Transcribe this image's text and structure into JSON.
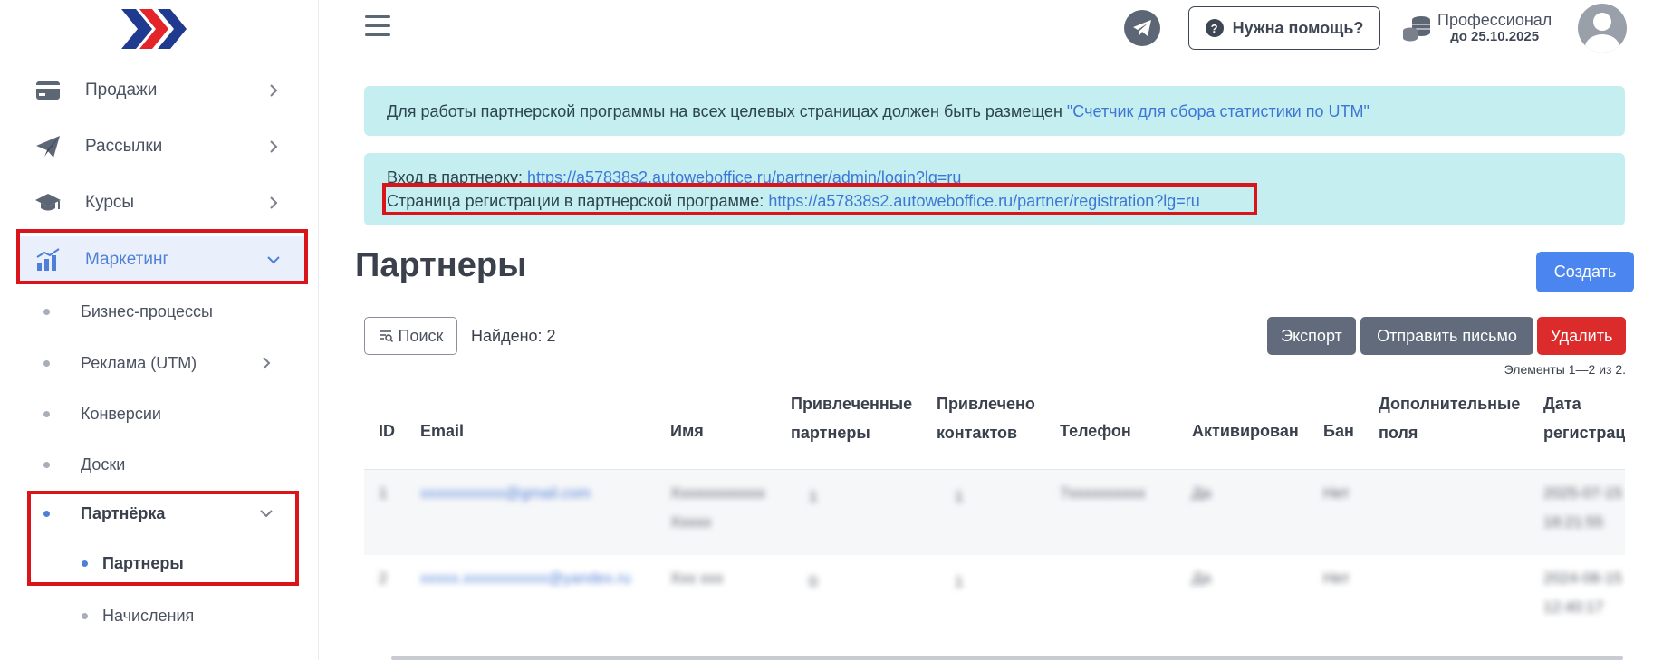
{
  "sidebar": {
    "items": [
      {
        "label": "Продажи"
      },
      {
        "label": "Рассылки"
      },
      {
        "label": "Курсы"
      },
      {
        "label": "Маркетинг"
      }
    ],
    "sub_items": [
      {
        "label": "Бизнес-процессы"
      },
      {
        "label": "Реклама (UTM)"
      },
      {
        "label": "Конверсии"
      },
      {
        "label": "Доски"
      },
      {
        "label": "Партнёрка"
      }
    ],
    "subsub_items": [
      {
        "label": "Партнеры"
      },
      {
        "label": "Начисления"
      }
    ]
  },
  "header": {
    "help_label": "Нужна помощь?",
    "plan_name": "Профессионал",
    "plan_until": "до 25.10.2025"
  },
  "alerts": {
    "utm_text": "Для работы партнерской программы на всех целевых страницах должен быть размещен ",
    "utm_link": "\"Счетчик для сбора статистики по UTM\"",
    "login_label": "Вход в партнерку: ",
    "login_url": "https://a57838s2.autoweboffice.ru/partner/admin/login?lg=ru",
    "reg_label": "Страница регистрации в партнерской программе: ",
    "reg_url": "https://a57838s2.autoweboffice.ru/partner/registration?lg=ru"
  },
  "page": {
    "title": "Партнеры",
    "create_label": "Создать",
    "search_label": "Поиск",
    "found_label": "Найдено: 2",
    "export_label": "Экспорт",
    "send_label": "Отправить письмо",
    "delete_label": "Удалить",
    "elements_count": "Элементы 1—2 из 2."
  },
  "table": {
    "columns": [
      {
        "l1": "ID",
        "l2": ""
      },
      {
        "l1": "Email",
        "l2": ""
      },
      {
        "l1": "Имя",
        "l2": ""
      },
      {
        "l1": "Привлеченные",
        "l2": "партнеры"
      },
      {
        "l1": "Привлечено",
        "l2": "контактов"
      },
      {
        "l1": "Телефон",
        "l2": ""
      },
      {
        "l1": "Активирован",
        "l2": ""
      },
      {
        "l1": "Бан",
        "l2": ""
      },
      {
        "l1": "Дополнительные",
        "l2": "поля"
      },
      {
        "l1": "Дата",
        "l2": "регистрации"
      }
    ],
    "rows": [
      {
        "id": "1",
        "email": "xxxxxxxxxxx@gmail.com",
        "name1": "Xxxxxxxxxxxx",
        "name2": "Xxxxx",
        "partners": "1",
        "contacts": "1",
        "phone": "7xxxxxxxxxx",
        "active": "Да",
        "ban": "Нет",
        "date1": "2025-07-15",
        "date2": "18:21:55"
      },
      {
        "id": "2",
        "email": "xxxxx.xxxxxxxxxxx@yandex.ru",
        "name1": "Xxx xxx",
        "name2": "",
        "partners": "0",
        "contacts": "1",
        "phone": "",
        "active": "Да",
        "ban": "Нет",
        "date1": "2024-08-15",
        "date2": "12:40:17"
      }
    ]
  }
}
